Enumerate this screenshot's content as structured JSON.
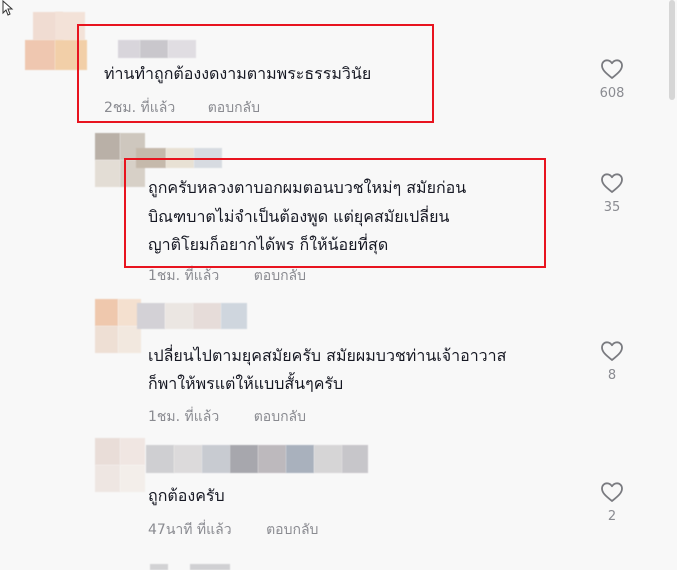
{
  "comments": [
    {
      "text": "ท่านทำถูกต้องงดงามตามพระธรรมวินัย",
      "time": "2ชม. ที่แล้ว",
      "reply": "ตอบกลับ",
      "likes": "608"
    },
    {
      "text_lines": [
        "ถูกครับหลวงตาบอกผมตอนบวชใหม่ๆ สมัยก่อน",
        "บิณฑบาตไม่จำเป็นต้องพูด แต่ยุคสมัยเปลี่ยน",
        "ญาติโยมก็อยากได้พร ก็ให้น้อยที่สุด"
      ],
      "time": "1ชม. ที่แล้ว",
      "reply": "ตอบกลับ",
      "likes": "35"
    },
    {
      "text_lines": [
        "เปลี่ยนไปตามยุคสมัยครับ สมัยผมบวชท่านเจ้าอาวาส",
        "ก็พาให้พรแต่ให้แบบสั้นๆครับ"
      ],
      "time": "1ชม. ที่แล้ว",
      "reply": "ตอบกลับ",
      "likes": "8"
    },
    {
      "text": "ถูกต้องครับ",
      "time": "47นาที ที่แล้ว",
      "reply": "ตอบกลับ",
      "likes": "2"
    }
  ],
  "colors": {
    "highlight": "#e8141f",
    "text": "#161823",
    "meta": "#8a8b91",
    "background": "#f8f8f8"
  },
  "icons": {
    "like": "heart-outline-icon",
    "cursor": "mouse-pointer-icon"
  }
}
